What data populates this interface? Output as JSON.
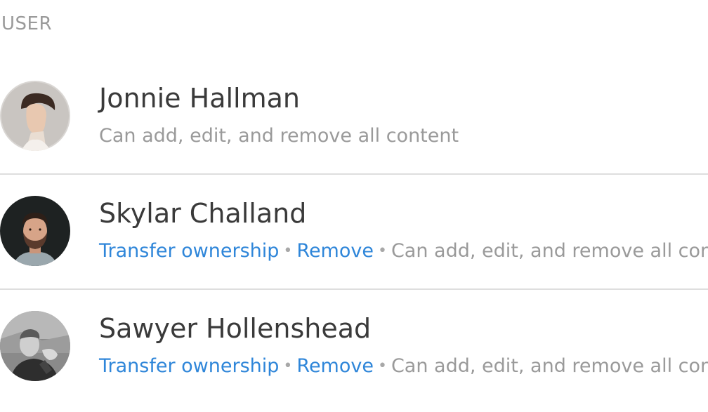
{
  "header": {
    "column_label": "USER"
  },
  "users": [
    {
      "name": "Jonnie Hallman",
      "permission": "Can add, edit, and remove all content",
      "avatar_icon": "avatar-photo"
    },
    {
      "name": "Skylar Challand",
      "transfer_label": "Transfer ownership",
      "remove_label": "Remove",
      "separator": "•",
      "permission": "Can add, edit, and remove all content",
      "avatar_icon": "avatar-photo"
    },
    {
      "name": "Sawyer Hollenshead",
      "transfer_label": "Transfer ownership",
      "remove_label": "Remove",
      "separator": "•",
      "permission": "Can add, edit, and remove all content",
      "avatar_icon": "avatar-photo"
    }
  ],
  "colors": {
    "link": "#2f86d9",
    "name_text": "#3a3a3a",
    "muted_text": "#9a9a9a",
    "divider": "#dedede"
  }
}
